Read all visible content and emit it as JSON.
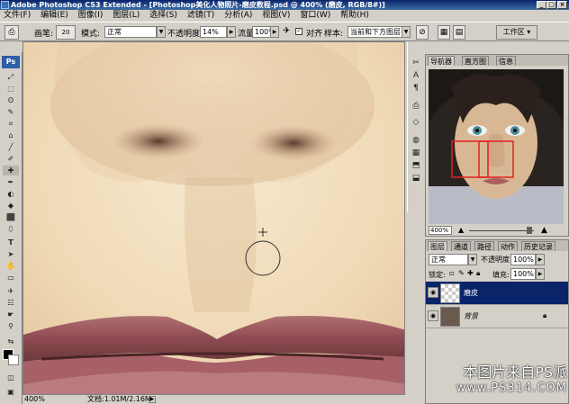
{
  "window": {
    "title": "Adobe Photoshop CS3 Extended - [Photoshop美化人物照片-磨皮教程.psd @ 400% (磨皮, RGB/8#)]",
    "controls": [
      "_",
      "□",
      "×"
    ]
  },
  "menubar": {
    "items": [
      "文件(F)",
      "编辑(E)",
      "图像(I)",
      "图层(L)",
      "选择(S)",
      "滤镜(T)",
      "分析(A)",
      "视图(V)",
      "窗口(W)",
      "帮助(H)"
    ]
  },
  "options": {
    "brush_label": "画笔:",
    "brush_size": "20",
    "mode_label": "模式:",
    "mode_value": "正常",
    "opacity_label": "不透明度:",
    "opacity_value": "14%",
    "flow_label": "流量:",
    "flow_value": "100%",
    "aligned_label": "对齐",
    "sample_label": "样本:",
    "sample_value": "当前和下方图层",
    "workspace_label": "工作区"
  },
  "toolbox": {
    "logo": "Ps",
    "tools": [
      "⤢",
      "⬚",
      "ʘ",
      "✎",
      "⌗",
      "⌂",
      "╱",
      "✐",
      "✚",
      "✒",
      "◐",
      "◆",
      "⬛",
      "⬯",
      "T",
      "➤",
      "✋",
      "▭",
      "✈",
      "☷",
      "☛",
      "⚲",
      "⇆"
    ]
  },
  "document": {
    "status_zoom": "400%",
    "status_doc": "文档:1.01M/2.16M"
  },
  "navigator": {
    "tabs": [
      "导航器",
      "直方图",
      "信息"
    ],
    "zoom": "400%"
  },
  "layers": {
    "tabs": [
      "图层",
      "通道",
      "路径",
      "动作",
      "历史记录"
    ],
    "blend_mode": "正常",
    "opacity_label": "不透明度:",
    "opacity_value": "100%",
    "lock_label": "锁定:",
    "fill_label": "填充:",
    "fill_value": "100%",
    "items": [
      {
        "name": "磨皮",
        "selected": true
      },
      {
        "name": "背景",
        "selected": false
      }
    ]
  },
  "watermark": {
    "line1": "本图片来自PS派",
    "line2": "www.PS314.COM"
  },
  "colors": {
    "selection": "#0a246a",
    "chrome": "#d4d0c8",
    "titlebar": "#0a246a"
  }
}
